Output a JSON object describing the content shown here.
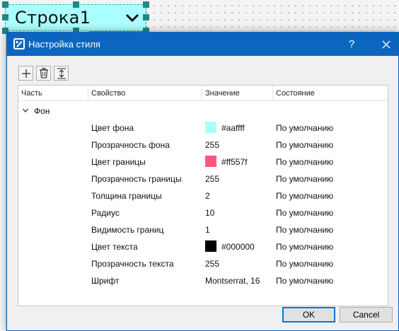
{
  "canvas": {
    "widget_text": "Строка1",
    "widget_background": "#aaffff",
    "widget_border_accent": "#ff557f",
    "handle_color": "#1a8a87"
  },
  "dialog": {
    "title": "Настройка стиля",
    "help_label": "?",
    "titlebar_color": "#0c66bf",
    "icons": {
      "app": "style-settings-icon",
      "close": "close-icon"
    }
  },
  "toolbar": {
    "buttons": [
      {
        "name": "add-button",
        "icon": "plus-icon"
      },
      {
        "name": "delete-button",
        "icon": "trash-icon"
      },
      {
        "name": "expand-collapse-button",
        "icon": "expand-vertical-icon"
      }
    ]
  },
  "table": {
    "columns": [
      "Часть",
      "Свойство",
      "Значение",
      "Состояние"
    ],
    "group": {
      "label": "Фон",
      "expanded": true
    },
    "rows": [
      {
        "property": "Цвет фона",
        "value": "#aaffff",
        "swatch": "#aaffff",
        "state": "По умолчанию"
      },
      {
        "property": "Прозрачность фона",
        "value": "255",
        "state": "По умолчанию"
      },
      {
        "property": "Цвет границы",
        "value": "#ff557f",
        "swatch": "#ff557f",
        "state": "По умолчанию"
      },
      {
        "property": "Прозрачность границы",
        "value": "255",
        "state": "По умолчанию"
      },
      {
        "property": "Толщина границы",
        "value": "2",
        "state": "По умолчанию"
      },
      {
        "property": "Радиус",
        "value": "10",
        "state": "По умолчанию"
      },
      {
        "property": "Видимость границ",
        "value": "1",
        "state": "По умолчанию"
      },
      {
        "property": "Цвет текста",
        "value": "#000000",
        "swatch": "#000000",
        "state": "По умолчанию"
      },
      {
        "property": "Прозрачность текста",
        "value": "255",
        "state": "По умолчанию"
      },
      {
        "property": "Шрифт",
        "value": "Montserrat, 16",
        "state": "По умолчанию"
      }
    ]
  },
  "buttons": {
    "ok": "OK",
    "cancel": "Cancel"
  }
}
